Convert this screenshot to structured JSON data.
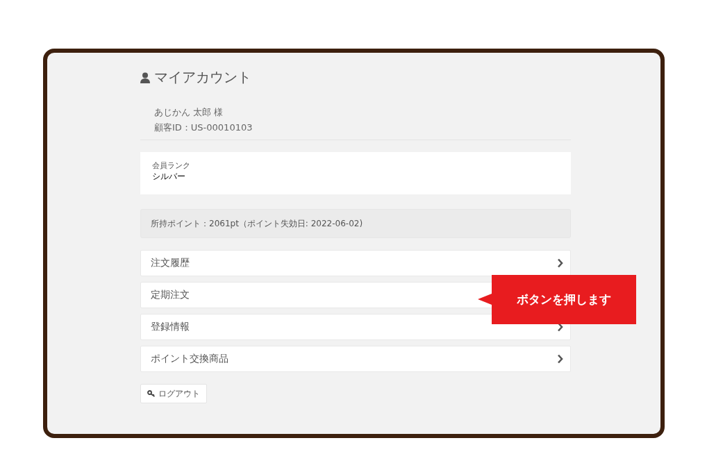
{
  "account": {
    "title": "マイアカウント",
    "name": "あじかん 太郎 様",
    "customer_id": "顧客ID：US-00010103"
  },
  "rank": {
    "label": "会員ランク",
    "value": "シルバー"
  },
  "points": "所持ポイント：2061pt（ポイント失効日: 2022-06-02)",
  "menu": [
    {
      "label": "注文履歴",
      "arrow": true
    },
    {
      "label": "定期注文",
      "arrow": false
    },
    {
      "label": "登録情報",
      "arrow": true
    },
    {
      "label": "ポイント交換商品",
      "arrow": true
    }
  ],
  "logout": "ログアウト",
  "callout": "ボタンを押します"
}
